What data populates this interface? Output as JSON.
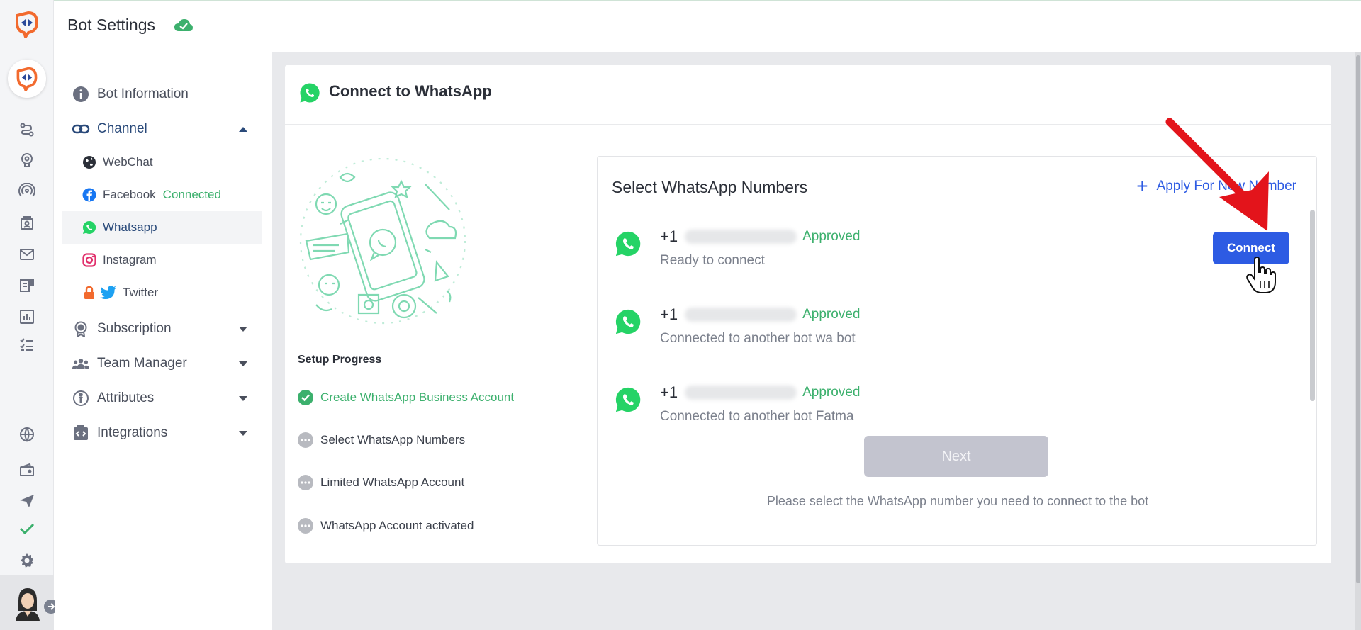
{
  "header": {
    "title": "Bot Settings"
  },
  "rail": {
    "icons": [
      "flow-icon",
      "brain-icon",
      "broadcast-icon",
      "contacts-icon",
      "mail-icon",
      "forms-icon",
      "analytics-icon",
      "tasks-icon",
      "globe-icon",
      "wallet-icon",
      "send-icon",
      "check-icon",
      "settings-icon"
    ]
  },
  "sidebar": {
    "bot_information": "Bot Information",
    "channel": "Channel",
    "channels": {
      "webchat": "WebChat",
      "facebook": "Facebook",
      "facebook_status": "Connected",
      "whatsapp": "Whatsapp",
      "instagram": "Instagram",
      "twitter": "Twitter"
    },
    "subscription": "Subscription",
    "team_manager": "Team Manager",
    "attributes": "Attributes",
    "integrations": "Integrations"
  },
  "card": {
    "title": "Connect to WhatsApp",
    "setup_progress": {
      "title": "Setup Progress",
      "steps": [
        {
          "label": "Create WhatsApp Business Account",
          "done": true
        },
        {
          "label": "Select WhatsApp Numbers",
          "done": false
        },
        {
          "label": "Limited WhatsApp Account",
          "done": false
        },
        {
          "label": "WhatsApp Account activated",
          "done": false
        }
      ]
    },
    "numbers": {
      "title": "Select WhatsApp Numbers",
      "apply_label": "Apply For New Number",
      "rows": [
        {
          "prefix": "+1",
          "status": "Approved",
          "desc": "Ready to connect",
          "action": "Connect"
        },
        {
          "prefix": "+1",
          "status": "Approved",
          "desc": "Connected to another bot wa bot"
        },
        {
          "prefix": "+1",
          "status": "Approved",
          "desc": "Connected to another bot Fatma"
        }
      ],
      "next_label": "Next",
      "hint": "Please select the WhatsApp number you need to connect to the bot"
    }
  },
  "colors": {
    "accent": "#2d5be3",
    "success": "#3cb06d",
    "whatsapp": "#25d366",
    "annotation": "#e3141b"
  }
}
